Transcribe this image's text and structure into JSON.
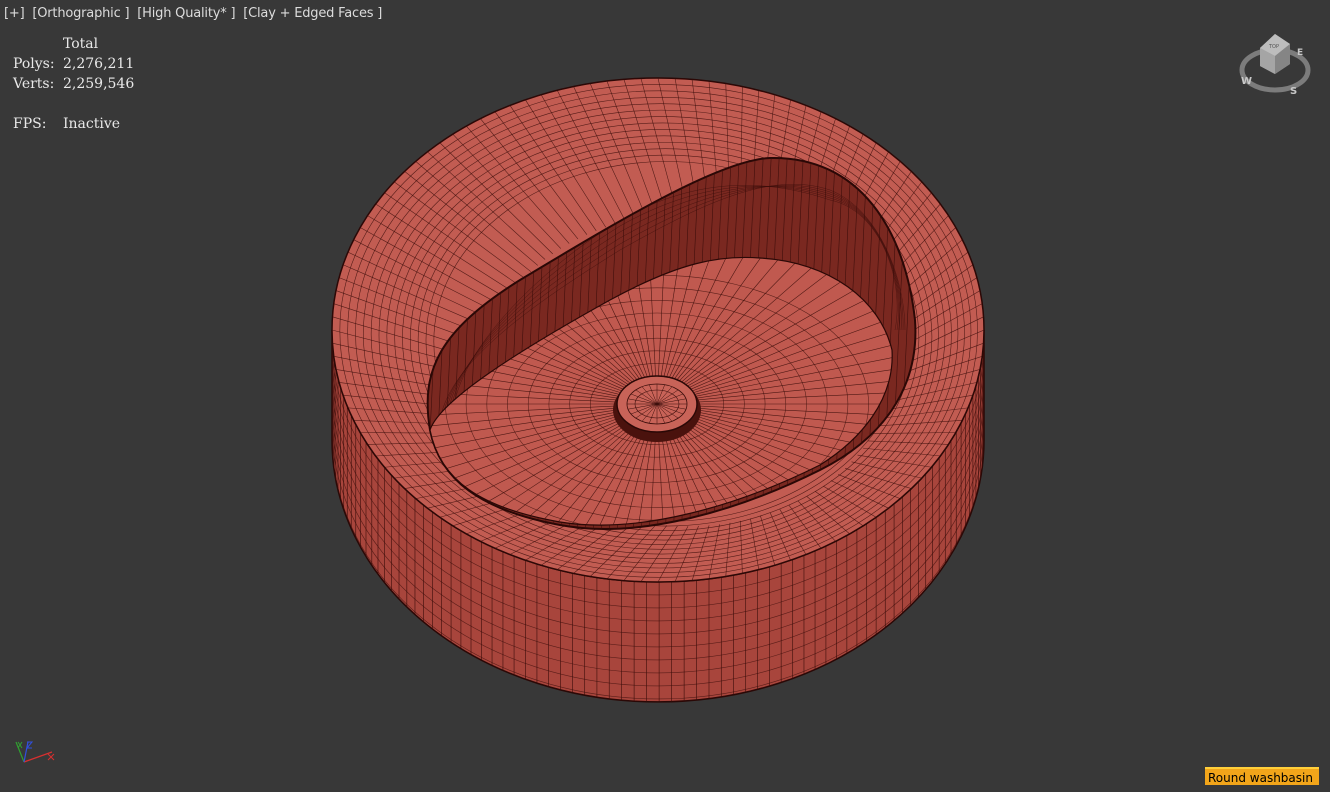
{
  "viewport": {
    "labels": {
      "menu": "[+]",
      "view": "[Orthographic ]",
      "quality": "[High Quality* ]",
      "shading": "[Clay + Edged Faces ]"
    },
    "stats": {
      "header": "Total",
      "polys_label": "Polys:",
      "polys_value": "2,276,211",
      "verts_label": "Verts:",
      "verts_value": "2,259,546",
      "fps_label": "FPS:",
      "fps_value": "Inactive"
    },
    "viewcube": {
      "face": "TOP",
      "compass": {
        "n": "",
        "e": "E",
        "s": "S",
        "w": "W"
      }
    },
    "object_label": "Round washbasin",
    "colors": {
      "background": "#383838",
      "model": "#c05a50",
      "wire": "#3a0d0a",
      "label_bg": "#f2a51a"
    }
  }
}
